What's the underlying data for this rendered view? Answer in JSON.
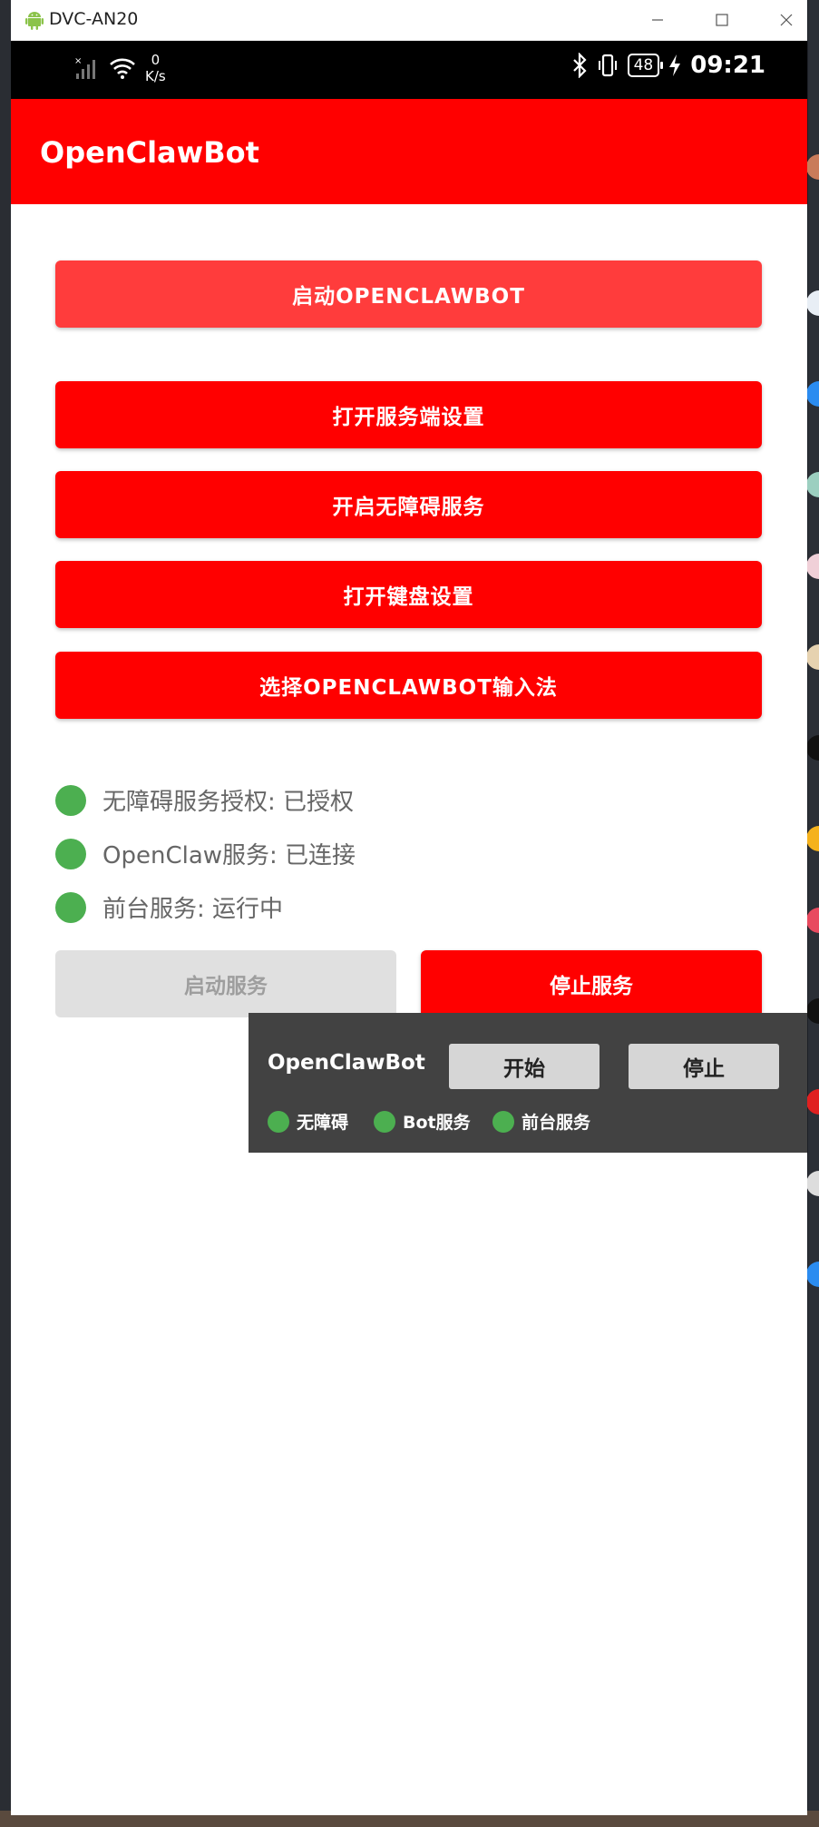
{
  "window": {
    "title": "DVC-AN20"
  },
  "statusbar": {
    "speed_value": "0",
    "speed_unit": "K/s",
    "battery": "48",
    "time": "09:21"
  },
  "app": {
    "title": "OpenClawBot"
  },
  "buttons": {
    "start_bot": "启动OPENCLAWBOT",
    "server_settings": "打开服务端设置",
    "accessibility": "开启无障碍服务",
    "keyboard_settings": "打开键盘设置",
    "select_ime": "选择OPENCLAWBOT输入法",
    "start_service": "启动服务",
    "stop_service": "停止服务"
  },
  "statuses": [
    {
      "text": "无障碍服务授权: 已授权",
      "color": "#4caf50"
    },
    {
      "text": "OpenClaw服务: 已连接",
      "color": "#4caf50"
    },
    {
      "text": "前台服务: 运行中",
      "color": "#4caf50"
    }
  ],
  "overlay": {
    "title": "OpenClawBot",
    "start_label": "开始",
    "stop_label": "停止",
    "status_items": [
      "无障碍",
      "Bot服务",
      "前台服务"
    ]
  },
  "colors": {
    "primary": "#ff0000",
    "primary_light": "#ff3c3c",
    "ok": "#4caf50"
  },
  "icons": [
    "android-icon",
    "minimize-icon",
    "maximize-icon",
    "close-icon",
    "signal-icon",
    "wifi-icon",
    "bluetooth-icon",
    "vibrate-icon",
    "battery-icon",
    "charging-icon"
  ]
}
